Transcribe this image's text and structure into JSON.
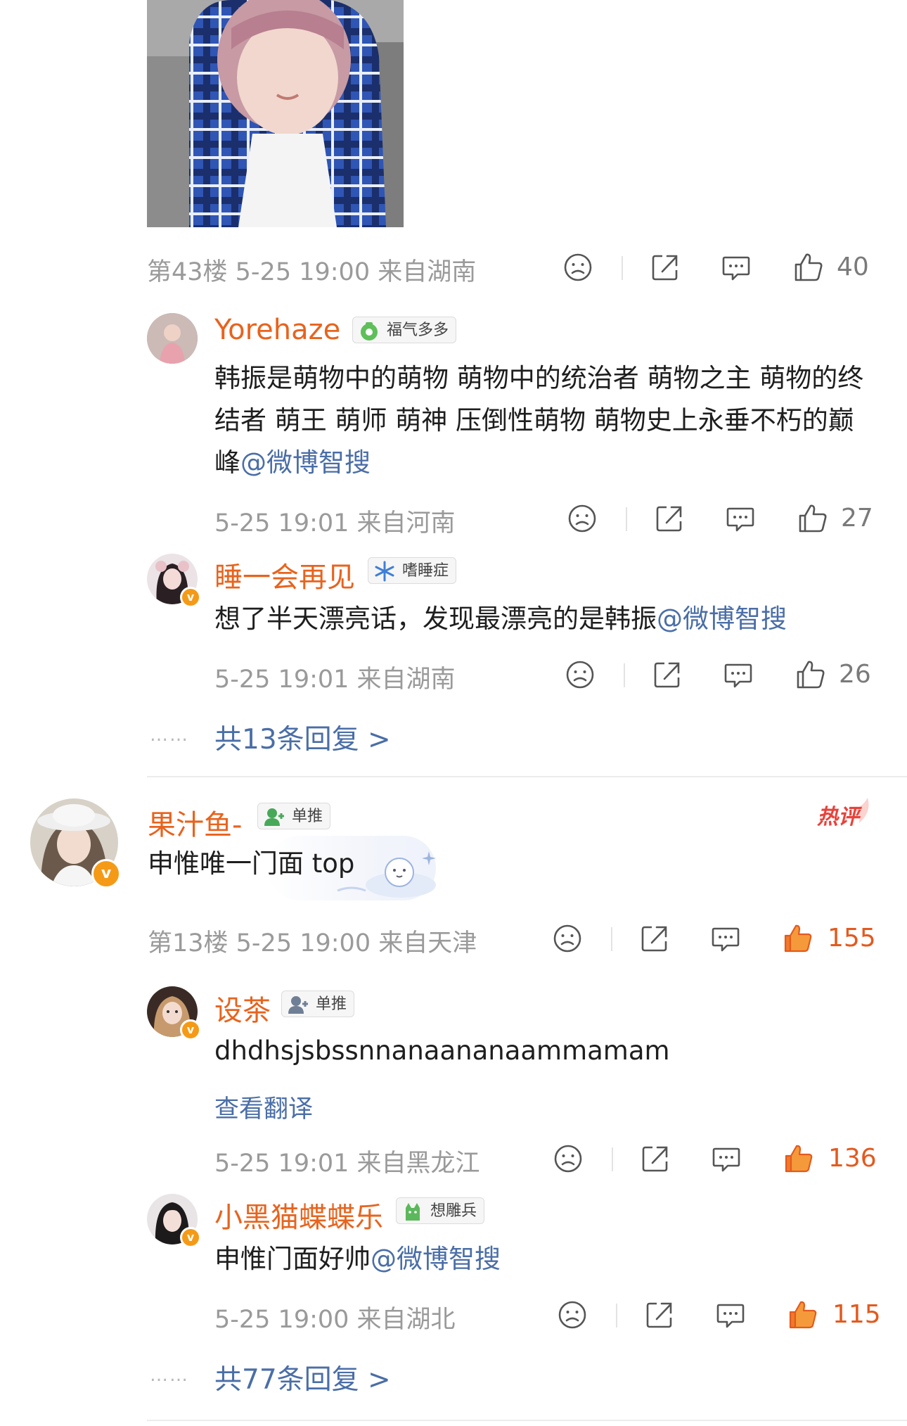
{
  "thread1": {
    "floor_meta": "第43楼 5-25 19:00 来自湖南",
    "likes": "40",
    "replies": [
      {
        "name": "Yorehaze",
        "badge": "福气多多",
        "text": "韩振是萌物中的萌物 萌物中的统治者 萌物之主 萌物的终结者 萌王 萌师 萌神 压倒性萌物 萌物史上永垂不朽的巅峰",
        "mention": "@微博智搜",
        "meta": "5-25 19:01 来自河南",
        "likes": "27"
      },
      {
        "name": "睡一会再见",
        "badge": "嗜睡症",
        "text": "想了半天漂亮话，发现最漂亮的是韩振",
        "mention": "@微博智搜",
        "meta": "5-25 19:01 来自湖南",
        "likes": "26"
      }
    ],
    "more_dots": "……",
    "more_replies": "共13条回复 >"
  },
  "thread2": {
    "name": "果汁鱼-",
    "badge": "单推",
    "hot_tag": "热评",
    "text": "申惟唯一门面 top",
    "floor_meta": "第13楼 5-25 19:00 来自天津",
    "likes": "155",
    "replies": [
      {
        "name": "设茶",
        "badge": "单推",
        "text": "dhdhsjsbssnnanaananaammamam",
        "translate": "查看翻译",
        "meta": "5-25 19:01 来自黑龙江",
        "likes": "136"
      },
      {
        "name": "小黑猫蝶蝶乐",
        "badge": "想雕兵",
        "text": "申惟门面好帅",
        "mention": "@微博智搜",
        "meta": "5-25 19:00 来自湖北",
        "likes": "115"
      }
    ],
    "more_dots": "……",
    "more_replies": "共77条回复 >"
  },
  "colors": {
    "username": "#e8631d",
    "link": "#4a6ea7",
    "meta": "#9a9a9a",
    "hot_like": "#e35a1e"
  },
  "icons": [
    "sad-face-icon",
    "share-icon",
    "comment-icon",
    "thumbs-up-icon",
    "verified-v-icon"
  ]
}
